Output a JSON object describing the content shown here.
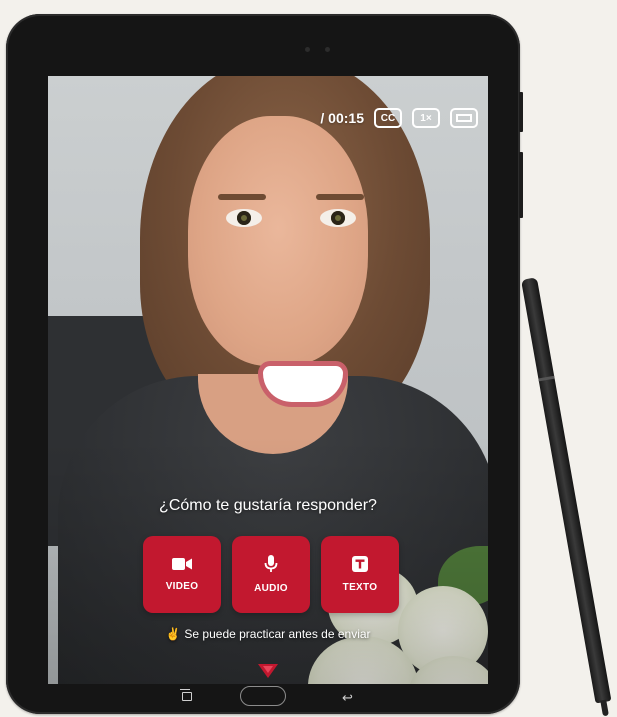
{
  "player": {
    "time": "/ 00:15",
    "cc_label": "CC",
    "speed_label": "1×"
  },
  "prompt": {
    "question": "¿Cómo te gustaría responder?",
    "hint": "Se puede practicar antes de enviar"
  },
  "options": [
    {
      "label": "VIDEO",
      "icon": "video-camera-icon"
    },
    {
      "label": "AUDIO",
      "icon": "microphone-icon"
    },
    {
      "label": "TEXTO",
      "icon": "text-icon"
    }
  ],
  "colors": {
    "accent": "#c2182f",
    "hint_icon": "#f4c430"
  }
}
